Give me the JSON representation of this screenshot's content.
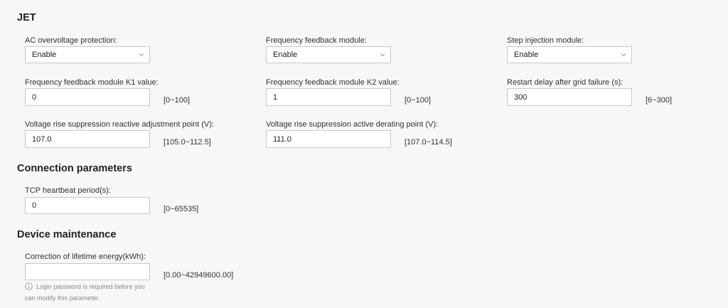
{
  "sections": {
    "jet": "JET",
    "connection": "Connection parameters",
    "maintenance": "Device maintenance"
  },
  "jet": {
    "ac_overvoltage": {
      "label": "AC overvoltage protection:",
      "value": "Enable"
    },
    "freq_feedback": {
      "label": "Frequency feedback module:",
      "value": "Enable"
    },
    "step_injection": {
      "label": "Step injection module:",
      "value": "Enable"
    },
    "k1": {
      "label": "Frequency feedback module K1 value:",
      "value": "0",
      "range": "[0~100]"
    },
    "k2": {
      "label": "Frequency feedback module K2 value:",
      "value": "1",
      "range": "[0~100]"
    },
    "restart_delay": {
      "label": "Restart delay after grid failure (s):",
      "value": "300",
      "range": "[6~300]"
    },
    "reactive_point": {
      "label": "Voltage rise suppression reactive adjustment point (V):",
      "value": "107.0",
      "range": "[105.0~112.5]"
    },
    "active_point": {
      "label": "Voltage rise suppression active derating point (V):",
      "value": "111.0",
      "range": "[107.0~114.5]"
    }
  },
  "connection": {
    "tcp_heartbeat": {
      "label": "TCP heartbeat period(s):",
      "value": "0",
      "range": "[0~65535]"
    }
  },
  "maintenance": {
    "lifetime_energy": {
      "label": "Correction of lifetime energy(kWh):",
      "value": "",
      "range": "[0.00~42949600.00]",
      "note_line1": "Login password is required before you",
      "note_line2": "can modify this parameter."
    }
  },
  "icons": {
    "dropdown": "chevron-down-icon",
    "info": "info-circle-icon"
  }
}
